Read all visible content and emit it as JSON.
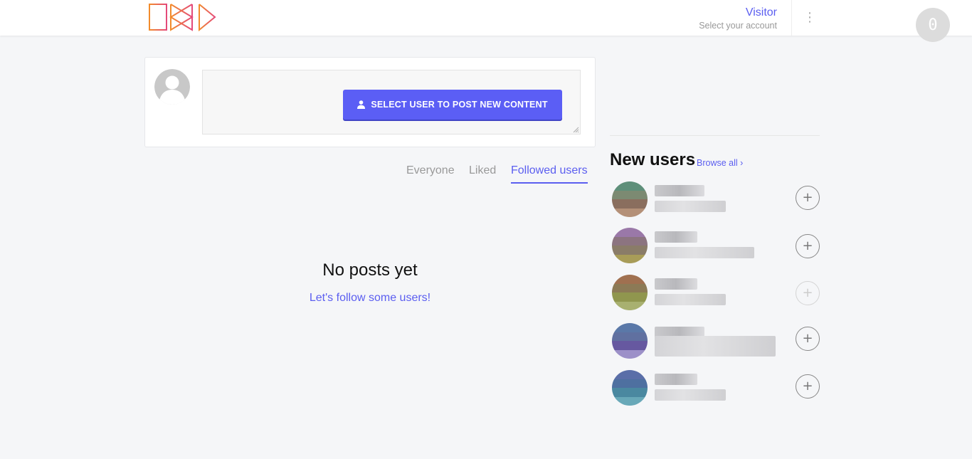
{
  "header": {
    "account_name": "Visitor",
    "account_hint": "Select your account",
    "notification_count": "0",
    "logo_colors": [
      "#f28c2b",
      "#e4497a"
    ]
  },
  "composer": {
    "post_button_label": "SELECT USER TO POST NEW CONTENT"
  },
  "feed": {
    "tabs": [
      {
        "label": "Everyone",
        "active": false
      },
      {
        "label": "Liked",
        "active": false
      },
      {
        "label": "Followed users",
        "active": true
      }
    ],
    "empty_title": "No posts yet",
    "empty_link": "Let's follow some users!"
  },
  "sidebar": {
    "title": "New users",
    "browse_label": "Browse all ›",
    "follow_symbol": "+",
    "users": [
      {
        "avatar_colors": [
          "#5e8f7a",
          "#7c8a72",
          "#8a6e5e",
          "#b49078"
        ]
      },
      {
        "avatar_colors": [
          "#9a78a8",
          "#8c7480",
          "#8a7c68",
          "#a89c58"
        ]
      },
      {
        "avatar_colors": [
          "#a07050",
          "#8c7a56",
          "#90964e",
          "#a8b070"
        ]
      },
      {
        "avatar_colors": [
          "#5a78a8",
          "#6070a0",
          "#6658a0",
          "#9c90c8"
        ]
      },
      {
        "avatar_colors": [
          "#5a6ea8",
          "#4e70a0",
          "#4a88a0",
          "#68a8b8"
        ]
      }
    ]
  },
  "colors": {
    "accent": "#5b5ef0",
    "button": "#5b5ef5",
    "background": "#f5f6f8"
  }
}
